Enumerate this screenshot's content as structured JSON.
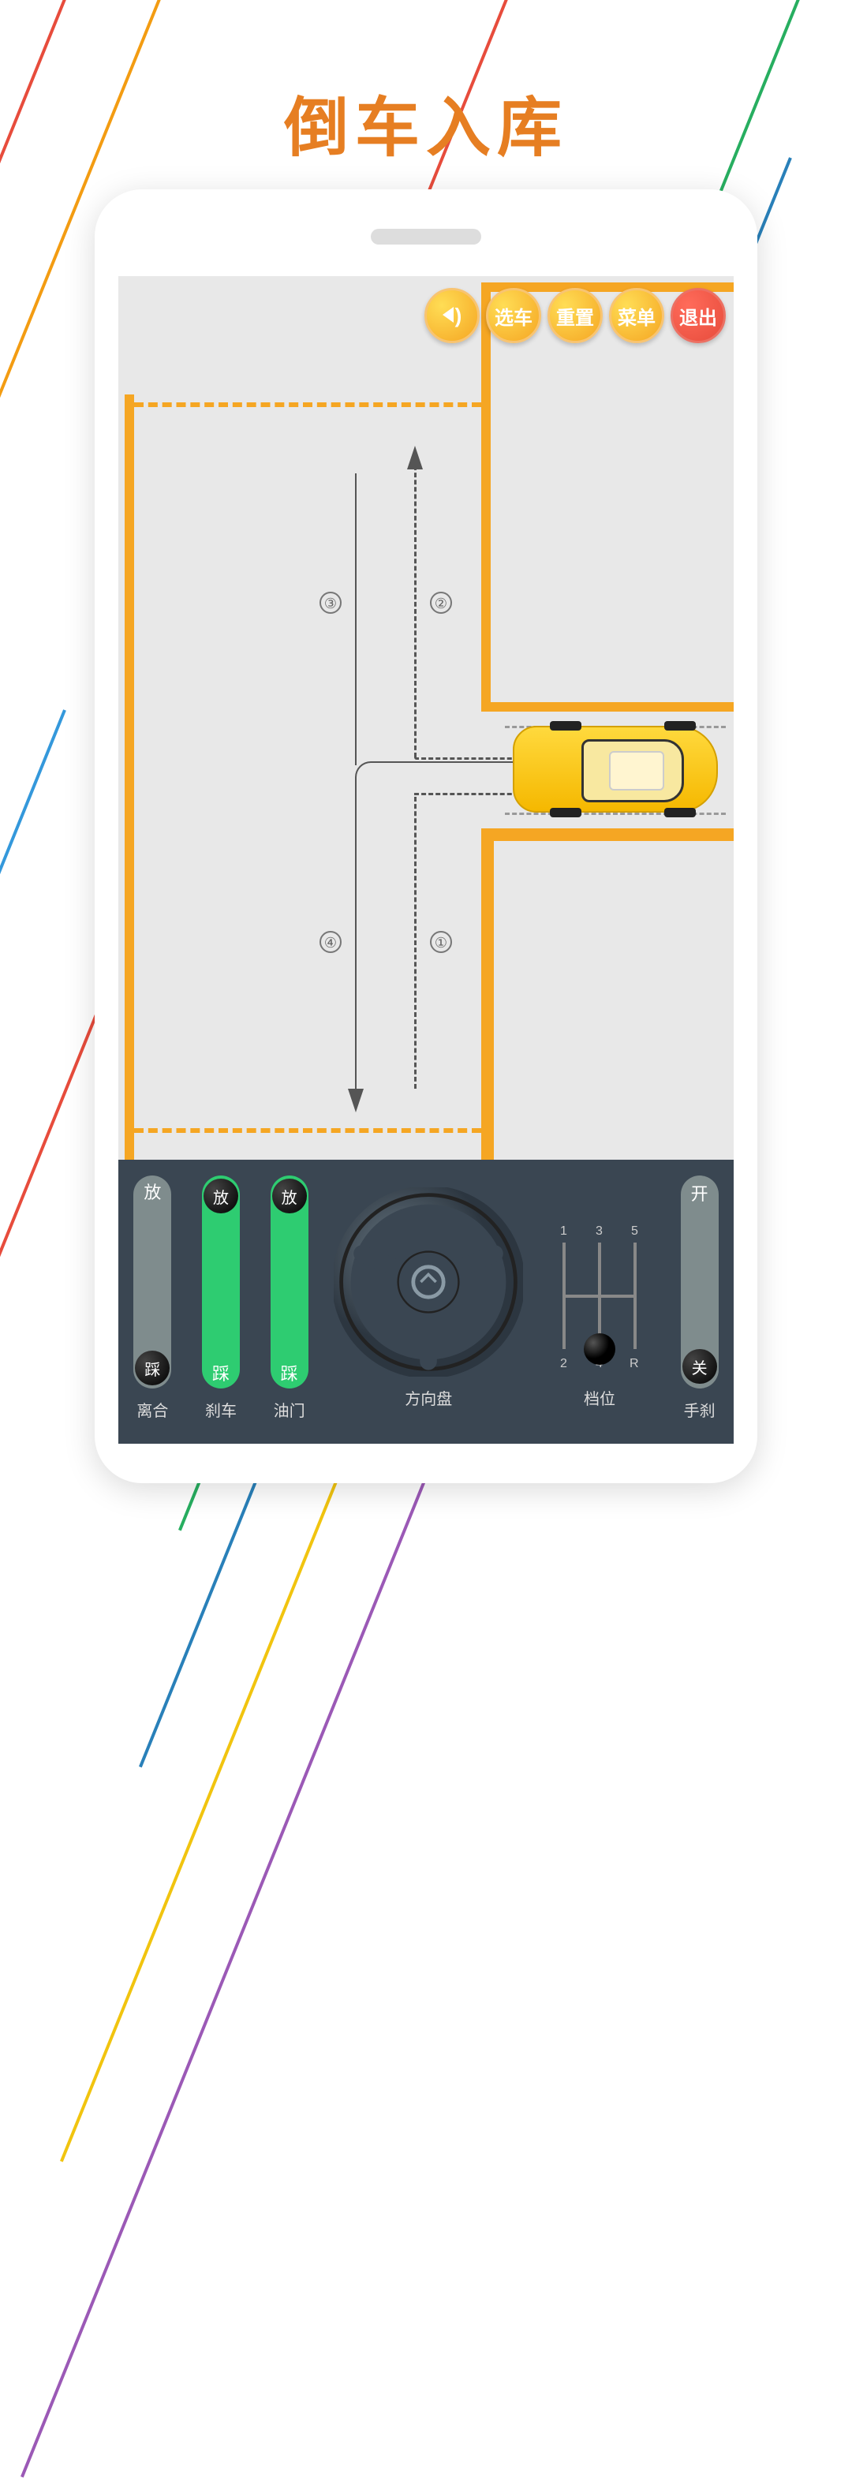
{
  "title": "倒车入库",
  "buttons": {
    "sound": "",
    "select_car": "选车",
    "reset": "重置",
    "menu": "菜单",
    "exit": "退出"
  },
  "path_markers": [
    "①",
    "②",
    "③",
    "④"
  ],
  "controls": {
    "clutch": {
      "label": "离合",
      "top": "放",
      "bottom": "踩",
      "active": false
    },
    "brake": {
      "label": "刹车",
      "top": "放",
      "bottom": "踩",
      "active": true
    },
    "throttle": {
      "label": "油门",
      "top": "放",
      "bottom": "踩",
      "active": true
    },
    "steering": {
      "label": "方向盘"
    },
    "gear": {
      "label": "档位",
      "positions": [
        "1",
        "2",
        "3",
        "4",
        "5",
        "R"
      ]
    },
    "handbrake": {
      "label": "手刹",
      "open": "开",
      "close": "关"
    }
  }
}
